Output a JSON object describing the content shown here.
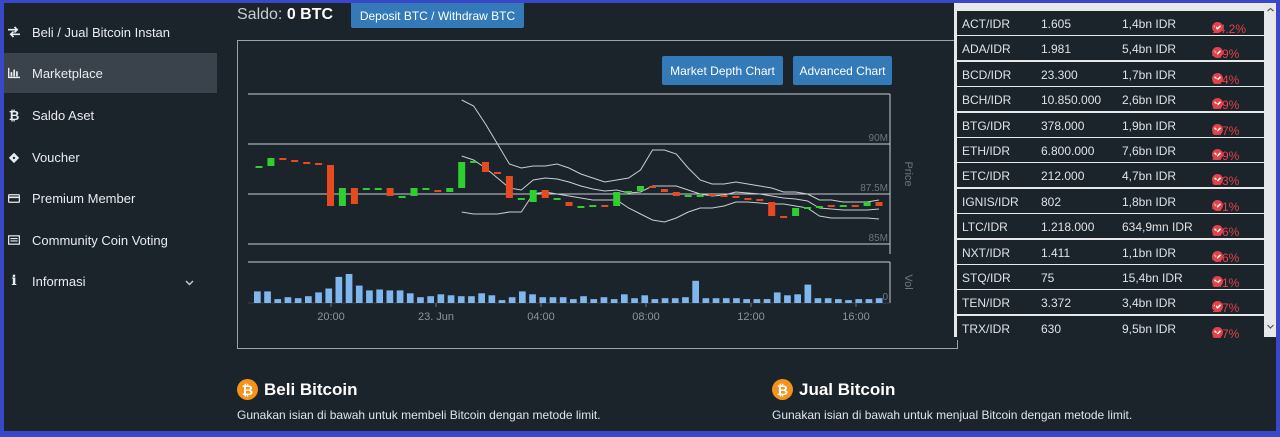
{
  "sidebar": {
    "items": [
      {
        "label": "Beli / Jual Bitcoin Instan",
        "icon": "exchange-arrows-icon",
        "active": false
      },
      {
        "label": "Marketplace",
        "icon": "bar-chart-icon",
        "active": true
      },
      {
        "label": "Saldo Aset",
        "icon": "bitcoin-icon",
        "active": false
      },
      {
        "label": "Voucher",
        "icon": "ticket-icon",
        "active": false
      },
      {
        "label": "Premium Member",
        "icon": "credit-card-icon",
        "active": false
      },
      {
        "label": "Community Coin Voting",
        "icon": "list-box-icon",
        "active": false
      },
      {
        "label": "Informasi",
        "icon": "info-icon",
        "active": false,
        "dropdown": true
      }
    ]
  },
  "header": {
    "saldo_label": "Saldo:",
    "saldo_value": "0 BTC",
    "deposit_button": "Deposit BTC / Withdraw BTC"
  },
  "chart": {
    "market_depth_button": "Market Depth Chart",
    "advanced_chart_button": "Advanced Chart"
  },
  "chart_data": {
    "type": "candlestick",
    "price_axis_label": "Price",
    "volume_axis_label": "Vol",
    "price_ticks": [
      "90M",
      "87.5M",
      "85M"
    ],
    "volume_ticks": [
      "0"
    ],
    "x_ticks": [
      "20:00",
      "23. Jun",
      "04:00",
      "08:00",
      "12:00",
      "16:00"
    ],
    "ylim": [
      84.5,
      92.5
    ],
    "colors": {
      "up": "#2fcf2f",
      "down": "#e84a1f",
      "volume": "#7fb6ee",
      "band": "#c9ced3",
      "grid": "#c8cdd2"
    },
    "candles": [
      [
        88.8,
        88.9
      ],
      [
        88.9,
        89.3
      ],
      [
        89.3,
        89.2
      ],
      [
        89.2,
        89.1
      ],
      [
        89.1,
        89.05
      ],
      [
        89.05,
        88.95
      ],
      [
        88.95,
        86.9
      ],
      [
        86.9,
        87.8
      ],
      [
        87.8,
        87.0
      ],
      [
        87.8,
        87.8
      ],
      [
        87.8,
        87.8
      ],
      [
        87.8,
        87.4
      ],
      [
        87.4,
        87.4
      ],
      [
        87.4,
        87.8
      ],
      [
        87.8,
        87.8
      ],
      [
        87.7,
        87.6
      ],
      [
        87.6,
        87.8
      ],
      [
        87.8,
        89.1
      ],
      [
        89.1,
        89.15
      ],
      [
        89.1,
        88.6
      ],
      [
        88.6,
        88.5
      ],
      [
        88.4,
        87.3
      ],
      [
        87.3,
        87.3
      ],
      [
        87.1,
        87.7
      ],
      [
        87.7,
        87.3
      ],
      [
        87.3,
        87.3
      ],
      [
        87.1,
        86.9
      ],
      [
        86.9,
        86.9
      ],
      [
        86.9,
        86.95
      ],
      [
        86.95,
        86.9
      ],
      [
        86.9,
        87.6
      ],
      [
        87.6,
        87.65
      ],
      [
        87.65,
        87.9
      ],
      [
        87.9,
        87.8
      ],
      [
        87.75,
        87.6
      ],
      [
        87.6,
        87.4
      ],
      [
        87.4,
        87.45
      ],
      [
        87.45,
        87.45
      ],
      [
        87.5,
        87.45
      ],
      [
        87.45,
        87.4
      ],
      [
        87.4,
        87.3
      ],
      [
        87.3,
        87.2
      ],
      [
        87.25,
        87.2
      ],
      [
        87.1,
        86.4
      ],
      [
        86.4,
        86.35
      ],
      [
        86.4,
        86.8
      ],
      [
        86.85,
        86.85
      ],
      [
        86.9,
        86.9
      ],
      [
        86.95,
        86.9
      ],
      [
        86.95,
        86.95
      ],
      [
        86.95,
        86.9
      ],
      [
        86.9,
        87.1
      ],
      [
        87.1,
        86.9
      ]
    ],
    "volume": [
      12,
      12,
      4,
      6,
      5,
      7,
      11,
      15,
      27,
      30,
      18,
      13,
      14,
      13,
      13,
      10,
      6,
      7,
      9,
      8,
      7,
      7,
      10,
      8,
      3,
      6,
      12,
      9,
      6,
      6,
      6,
      4,
      7,
      4,
      6,
      4,
      9,
      5,
      8,
      4,
      5,
      5,
      6,
      23,
      5,
      5,
      5,
      5,
      4,
      4,
      4,
      11,
      8,
      9,
      19,
      5,
      5,
      4,
      3,
      4,
      4,
      5
    ],
    "band_upper": [
      null,
      null,
      null,
      null,
      null,
      null,
      null,
      null,
      null,
      null,
      null,
      null,
      null,
      null,
      null,
      null,
      null,
      92.2,
      91.9,
      91.0,
      90.0,
      89.0,
      88.8,
      88.9,
      88.9,
      89.0,
      88.8,
      88.5,
      88.3,
      88.1,
      88.2,
      88.3,
      88.7,
      89.7,
      89.7,
      89.5,
      88.8,
      88.2,
      88.0,
      88.0,
      88.1,
      88.0,
      87.9,
      87.8,
      87.6,
      87.6,
      87.5,
      87.2,
      87.2,
      87.1,
      87.1,
      87.1,
      87.2
    ],
    "band_lower": [
      null,
      null,
      null,
      null,
      null,
      null,
      null,
      null,
      null,
      null,
      null,
      null,
      null,
      null,
      null,
      null,
      null,
      86.6,
      86.5,
      86.5,
      86.5,
      86.6,
      86.6,
      87.5,
      87.6,
      87.5,
      87.4,
      87.3,
      87.2,
      87.2,
      87.2,
      86.8,
      86.5,
      86.2,
      86.1,
      86.3,
      86.6,
      86.8,
      86.8,
      86.9,
      87.1,
      87.1,
      87.05,
      87.0,
      87.0,
      86.9,
      86.8,
      86.4,
      86.3,
      86.3,
      86.3,
      86.3,
      86.25
    ],
    "band_mid": [
      null,
      null,
      null,
      null,
      null,
      null,
      null,
      null,
      null,
      null,
      null,
      null,
      null,
      null,
      null,
      null,
      null,
      89.4,
      89.2,
      88.8,
      88.3,
      87.8,
      87.7,
      88.2,
      88.3,
      88.25,
      88.1,
      87.9,
      87.75,
      87.65,
      87.7,
      87.55,
      87.6,
      87.9,
      87.9,
      87.9,
      87.7,
      87.5,
      87.4,
      87.45,
      87.6,
      87.55,
      87.5,
      87.4,
      87.3,
      87.25,
      87.15,
      86.8,
      86.75,
      86.7,
      86.7,
      86.7,
      86.75
    ]
  },
  "market": {
    "rows": [
      {
        "pair": "ACT/IDR",
        "price": "1.605",
        "volume": "1,4bn IDR",
        "change": "14.2%"
      },
      {
        "pair": "ADA/IDR",
        "price": "1.981",
        "volume": "5,4bn IDR",
        "change": "4.9%"
      },
      {
        "pair": "BCD/IDR",
        "price": "23.300",
        "volume": "1,7bn IDR",
        "change": "6.4%"
      },
      {
        "pair": "BCH/IDR",
        "price": "10.850.000",
        "volume": "2,6bn IDR",
        "change": "5.9%"
      },
      {
        "pair": "BTG/IDR",
        "price": "378.000",
        "volume": "1,9bn IDR",
        "change": "8.7%"
      },
      {
        "pair": "ETH/IDR",
        "price": "6.800.000",
        "volume": "7,6bn IDR",
        "change": "2.9%"
      },
      {
        "pair": "ETC/IDR",
        "price": "212.000",
        "volume": "4,7bn IDR",
        "change": "8.3%"
      },
      {
        "pair": "IGNIS/IDR",
        "price": "802",
        "volume": "1,8bn IDR",
        "change": "4.1%"
      },
      {
        "pair": "LTC/IDR",
        "price": "1.218.000",
        "volume": "634,9mn IDR",
        "change": "3.6%"
      },
      {
        "pair": "NXT/IDR",
        "price": "1.411",
        "volume": "1,1bn IDR",
        "change": "4.6%"
      },
      {
        "pair": "STQ/IDR",
        "price": "75",
        "volume": "15,4bn IDR",
        "change": "5.1%"
      },
      {
        "pair": "TEN/IDR",
        "price": "3.372",
        "volume": "3,4bn IDR",
        "change": "1.7%"
      },
      {
        "pair": "TRX/IDR",
        "price": "630",
        "volume": "9,5bn IDR",
        "change": "3.7%"
      }
    ]
  },
  "beli": {
    "title": "Beli Bitcoin",
    "description": "Gunakan isian di bawah untuk membeli Bitcoin dengan metode limit."
  },
  "jual": {
    "title": "Jual Bitcoin",
    "description": "Gunakan isian di bawah untuk menjual Bitcoin dengan metode limit."
  }
}
